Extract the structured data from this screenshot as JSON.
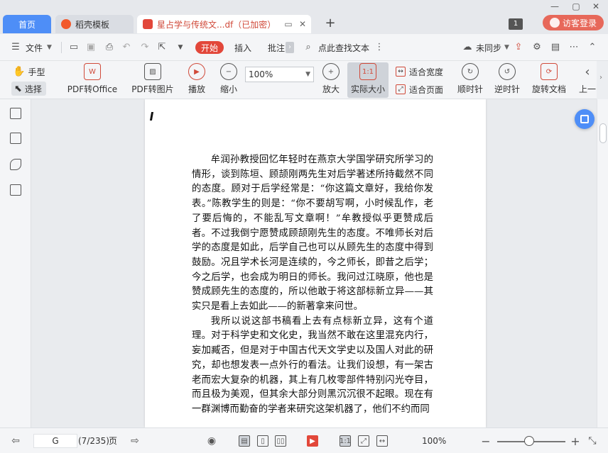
{
  "tabs": {
    "home": "首页",
    "template": "稻壳模板",
    "document": "星占学与传统文...df（已加密）"
  },
  "window": {
    "counter": "1",
    "login": "访客登录"
  },
  "menu": {
    "file": "文件",
    "start": "开始",
    "insert": "插入",
    "annotate": "批注",
    "search": "点此查找文本",
    "sync": "未同步"
  },
  "toolbar": {
    "hand": "手型",
    "select": "选择",
    "pdf_to_office": "PDF转Office",
    "pdf_to_image": "PDF转图片",
    "play": "播放",
    "zoom_out": "缩小",
    "zoom_value": "100%",
    "zoom_in": "放大",
    "actual_size": "实际大小",
    "fit_width": "适合宽度",
    "fit_page": "适合页面",
    "rotate_cw": "顺时针",
    "rotate_ccw": "逆时针",
    "rotate_doc": "旋转文档",
    "prev": "上一"
  },
  "document": {
    "paragraphs": [
      "牟润孙教授回忆年轻时在燕京大学国学研究所学习的情形，谈到陈垣、顾颉刚两先生对后学著述所持截然不同的态度。顾对于后学经常是：“你这篇文章好，我给你发表。”陈教学生的则是：“你不要胡写啊，小时候乱作，老了要后悔的，不能乱写文章啊！”牟教授似乎更赞成后者。不过我倒宁愿赞成顾颉刚先生的态度。不唯师长对后学的态度是如此，后学自己也可以从顾先生的态度中得到鼓励。况且学术长河是连续的，今之师长，即昔之后学；今之后学，也会成为明日的师长。我问过江晓原，他也是赞成顾先生的态度的，所以他敢于将这部标新立异——其实只是看上去如此——的新著拿来问世。",
      "我所以说这部书稿看上去有点标新立异，这有个道理。对于科学史和文化史，我当然不敢在这里混充内行，妄加臧否，但是对于中国古代天文学史以及国人对此的研究，却也想发表一点外行的看法。让我们设想，有一架古老而宏大复杂的机器，其上有几枚零部件特别闪光夺目，而且极为美观，但其余大部分则黑沉沉很不起眼。现在有一群渊博而勤奋的学者来研究这架机器了，他们不约而同"
    ]
  },
  "status": {
    "page_input": "G",
    "page_count": "(7/235)",
    "page_label": "页",
    "zoom": "100%"
  },
  "colors": {
    "accent": "#4e8ef7",
    "brand_red": "#e2473a"
  }
}
